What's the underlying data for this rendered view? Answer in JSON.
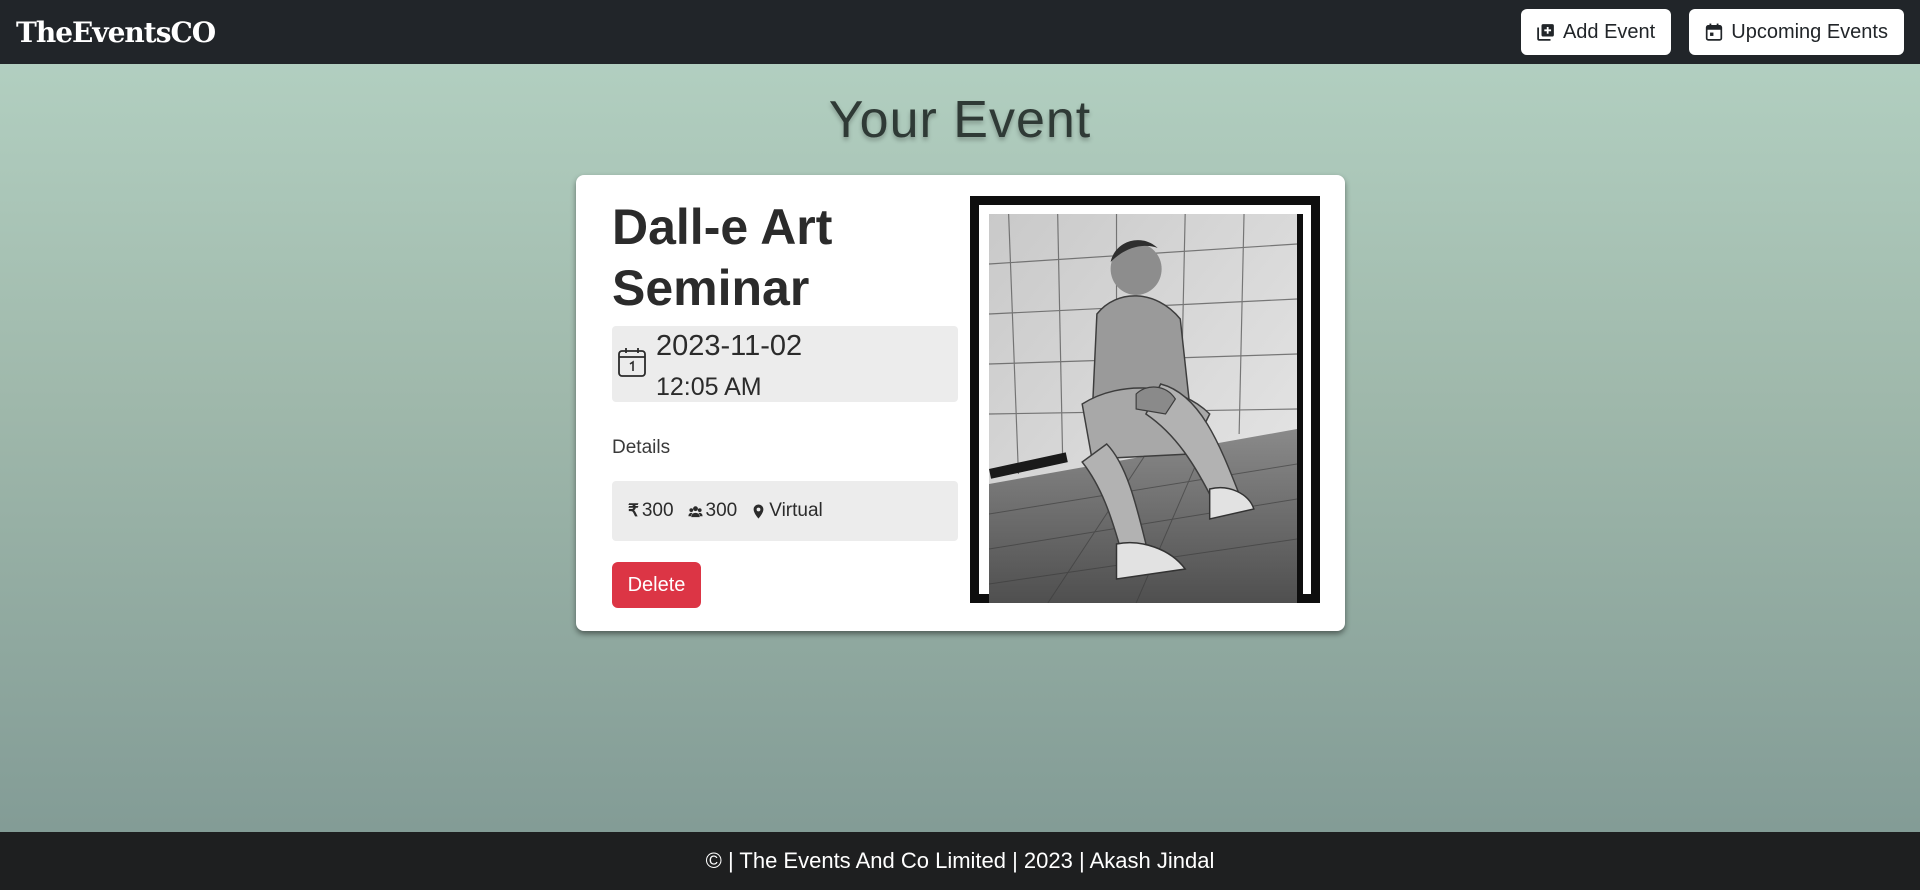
{
  "navbar": {
    "brand": "TheEventsCO",
    "add_event_label": "Add Event",
    "upcoming_events_label": "Upcoming Events",
    "background": "#212529"
  },
  "page": {
    "title": "Your Event"
  },
  "event": {
    "title": "Dall-e Art Seminar",
    "date": "2023-11-02",
    "time": "12:05 AM",
    "details_label": "Details",
    "price": "300",
    "capacity": "300",
    "location": "Virtual",
    "price_icon": "rupee-icon",
    "capacity_icon": "people-icon",
    "location_icon": "map-pin-icon",
    "delete_label": "Delete",
    "delete_color": "#dc3545"
  },
  "footer": {
    "text": "© | The Events And Co Limited | 2023 | Akash Jindal"
  }
}
